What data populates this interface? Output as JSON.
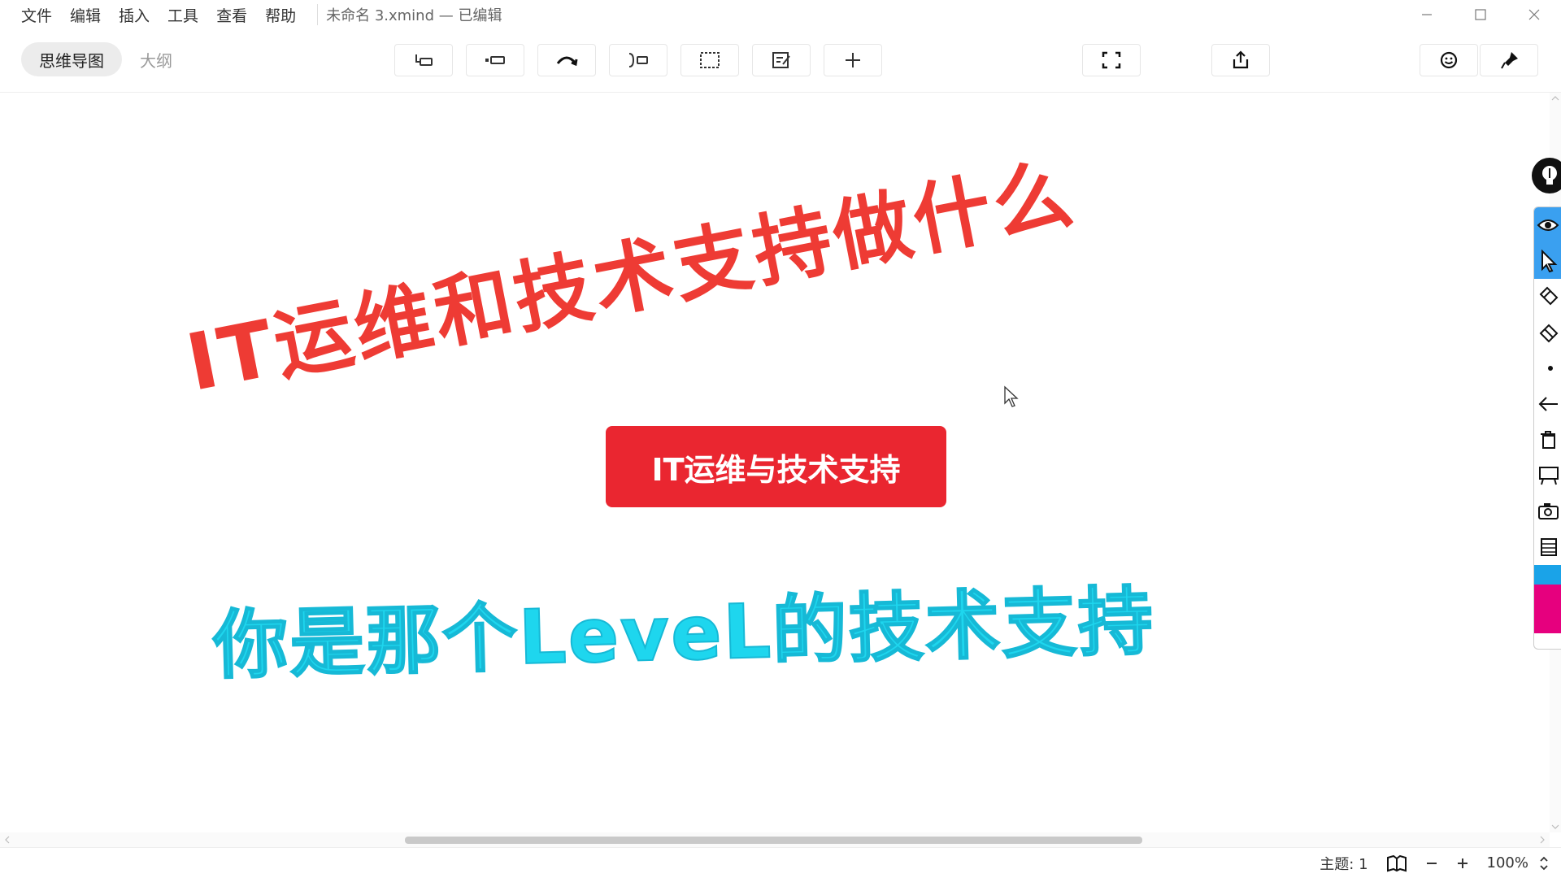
{
  "menu": {
    "items": [
      "文件",
      "编辑",
      "插入",
      "工具",
      "查看",
      "帮助"
    ],
    "document_title": "未命名 3.xmind — 已编辑"
  },
  "toolbar": {
    "views": [
      {
        "label": "思维导图",
        "active": true
      },
      {
        "label": "大纲",
        "active": false
      }
    ],
    "tools": [
      "subtopic-icon",
      "topic-icon",
      "relationship-icon",
      "summary-icon",
      "boundary-icon",
      "note-icon",
      "insert-icon",
      "zen-mode-icon",
      "share-icon",
      "emoji-icon",
      "format-icon"
    ]
  },
  "canvas": {
    "headline_red": "IT运维和技术支持做什么",
    "central_topic": "IT运维与技术支持",
    "headline_cyan": "你是那个LeveL的技术支持",
    "colors": {
      "red_text": "#ee3b34",
      "topic_fill": "#ea2630",
      "cyan_text": "#1ed6ee"
    }
  },
  "pen_overlay": {
    "tools": [
      "eye-icon",
      "pointer-icon",
      "highlighter-icon",
      "eraser-icon",
      "dot-icon",
      "undo-icon",
      "trash-icon",
      "whiteboard-icon",
      "camera-icon",
      "notes-icon"
    ],
    "swatches": [
      "#1aa3e8",
      "#e6007e"
    ]
  },
  "status": {
    "topics": "主题: 1",
    "zoom": "100%"
  }
}
